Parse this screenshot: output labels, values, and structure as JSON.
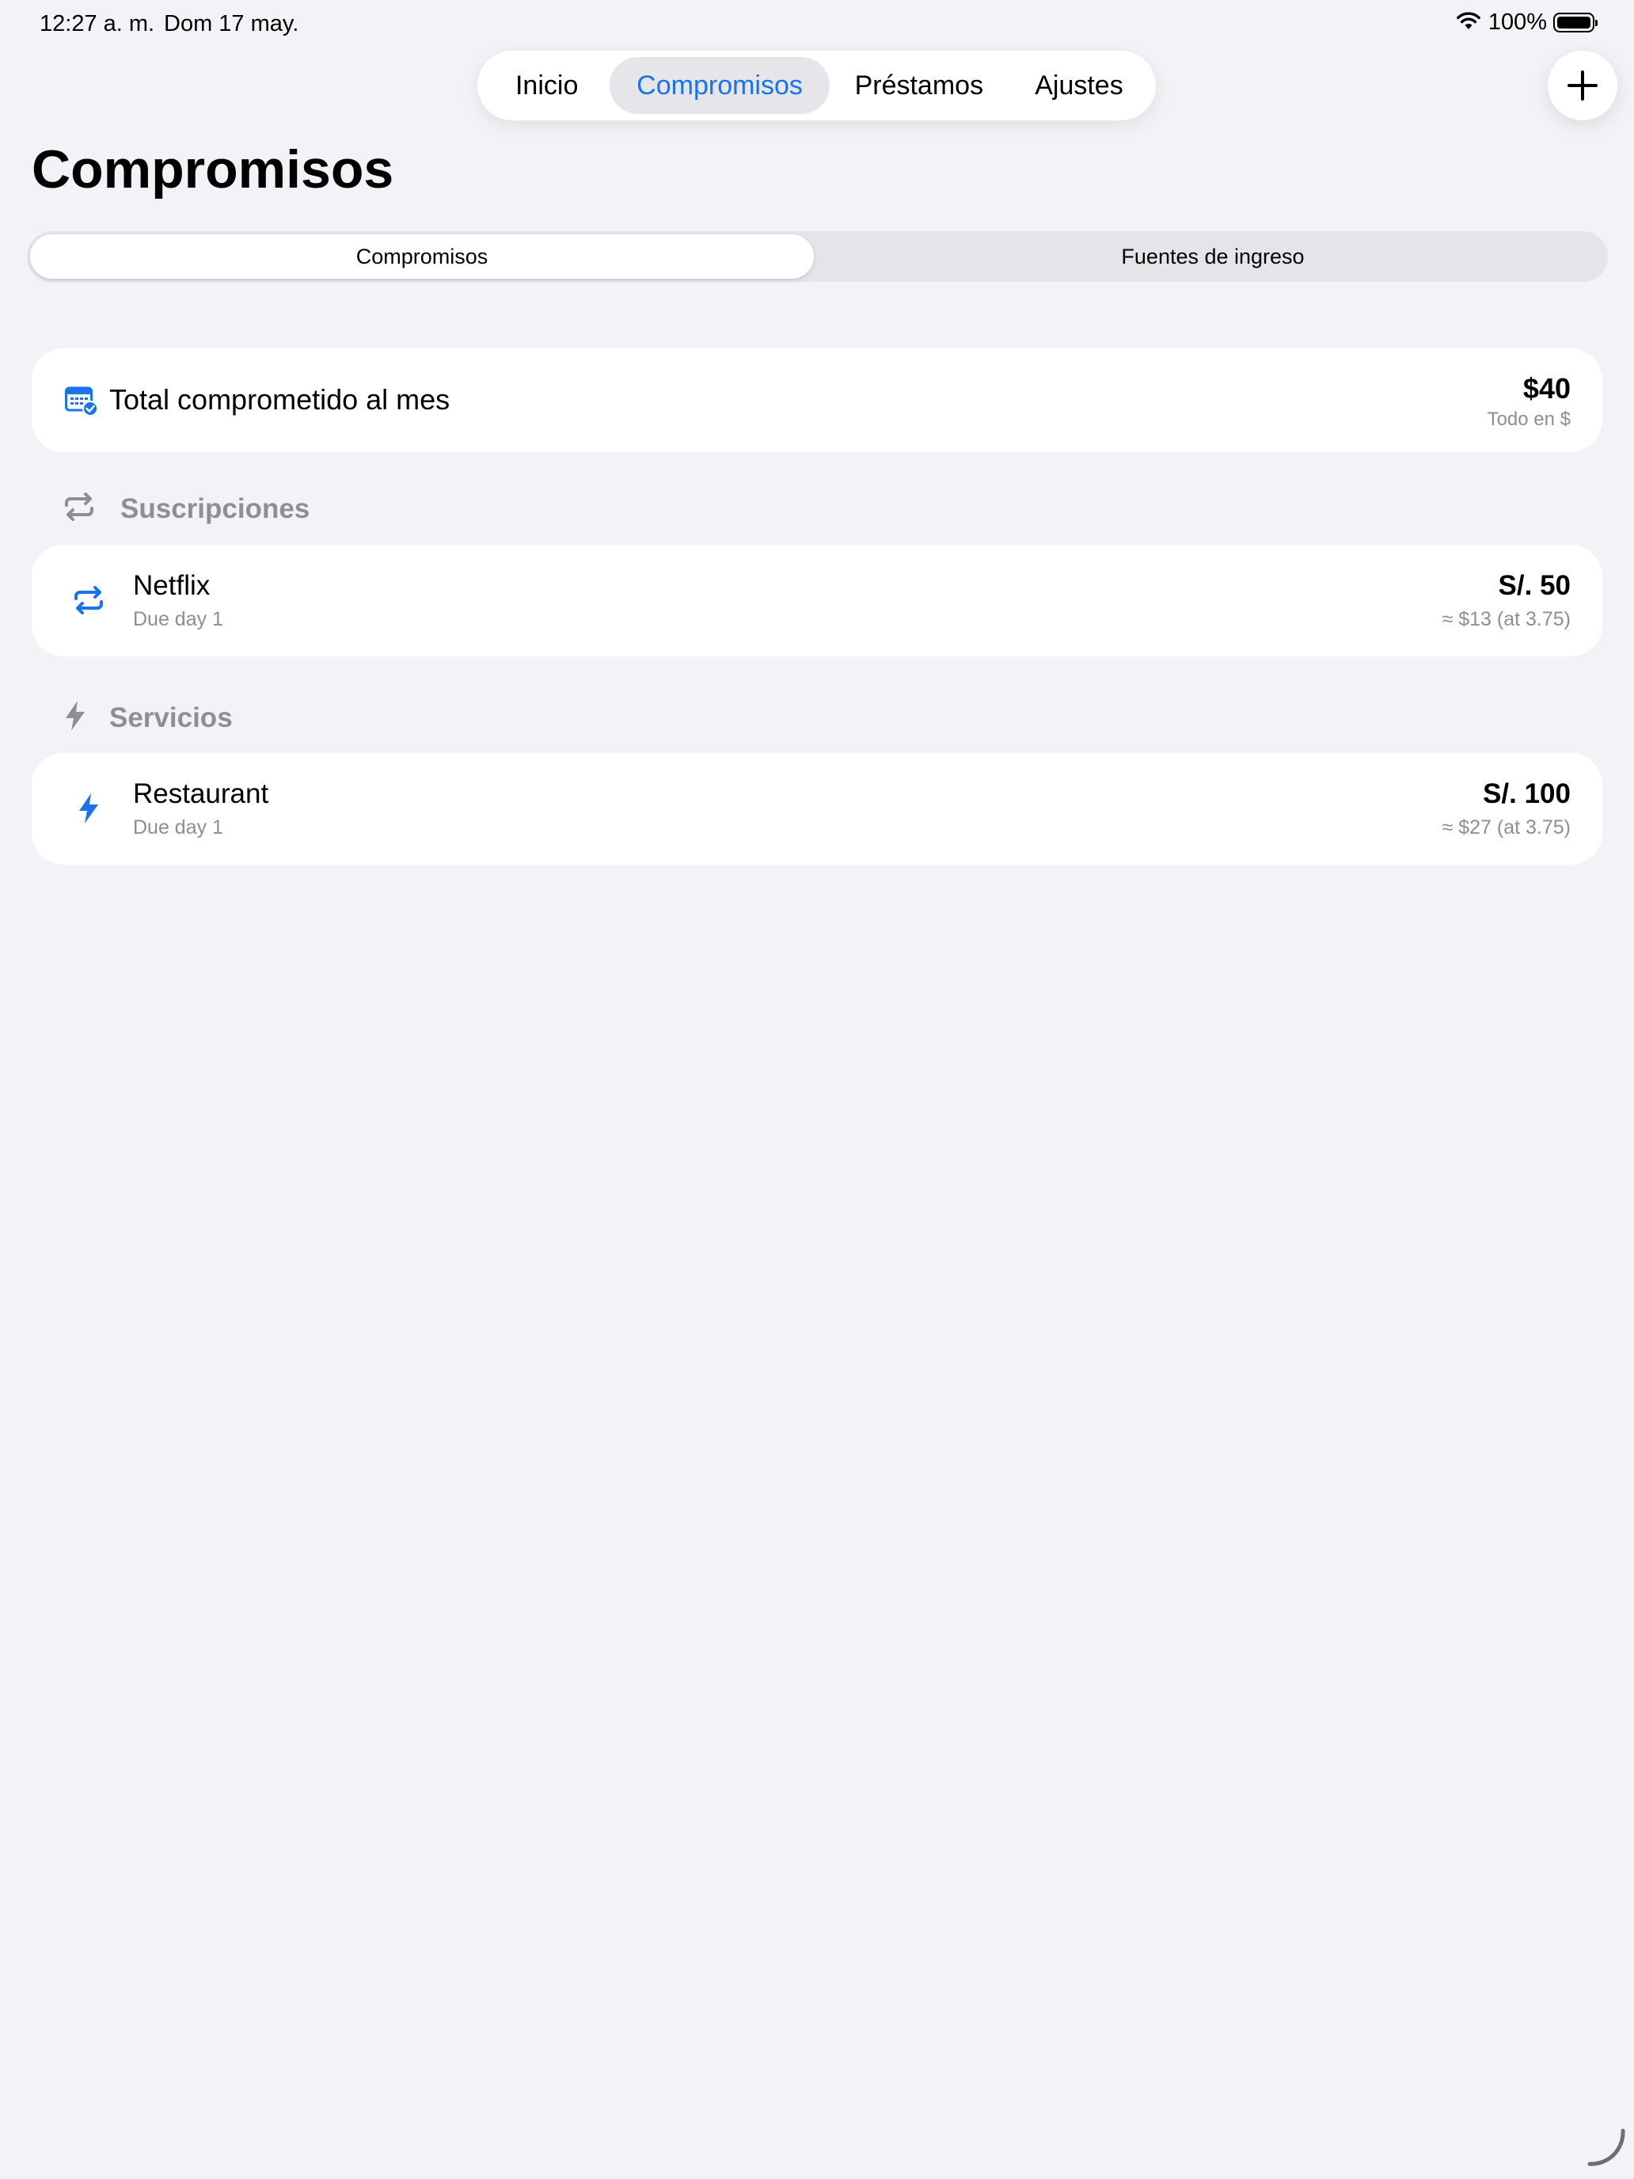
{
  "status_bar": {
    "time": "12:27 a. m.",
    "date": "Dom 17 may.",
    "battery": "100%"
  },
  "top_tabs": [
    {
      "label": "Inicio",
      "selected": false
    },
    {
      "label": "Compromisos",
      "selected": true
    },
    {
      "label": "Préstamos",
      "selected": false
    },
    {
      "label": "Ajustes",
      "selected": false
    }
  ],
  "page_title": "Compromisos",
  "segmented": {
    "options": [
      "Compromisos",
      "Fuentes de ingreso"
    ],
    "selected": "Compromisos"
  },
  "total": {
    "label": "Total comprometido al mes",
    "value": "$40",
    "sub": "Todo en $"
  },
  "sections": [
    {
      "title": "Suscripciones",
      "icon": "repeat-icon",
      "items": [
        {
          "name": "Netflix",
          "due": "Due day 1",
          "amount": "S/. 50",
          "converted": "≈ $13 (at 3.75)"
        }
      ]
    },
    {
      "title": "Servicios",
      "icon": "bolt-icon",
      "items": [
        {
          "name": "Restaurant",
          "due": "Due day 1",
          "amount": "S/. 100",
          "converted": "≈ $27 (at 3.75)"
        }
      ]
    }
  ],
  "colors": {
    "accent": "#1a73e8",
    "background": "#f2f2f7",
    "secondary_text": "#8e8e93"
  }
}
